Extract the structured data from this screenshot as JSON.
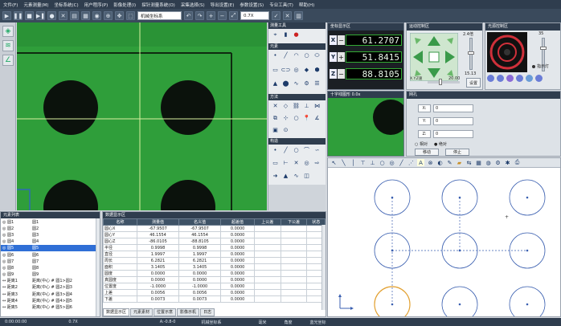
{
  "menubar": {
    "items": [
      "文件(F)",
      "元素测量(M)",
      "坐标系统(C)",
      "用户程序(P)",
      "影像处理(I)",
      "探针测量系统(O)",
      "采集选择(S)",
      "导出设置(E)",
      "参数设置(S)",
      "专业工具(T)",
      "帮助(H)"
    ]
  },
  "toolbar": {
    "coord_system": "机械坐标系",
    "zoom": "0.7X"
  },
  "camera": {
    "title": "",
    "crosshair_color": "#d8f0a0",
    "accent": "#2f9e3a"
  },
  "palette": {
    "measure_tools_title": "测量工具",
    "elements_title": "元素",
    "construct_title": "构造",
    "methods_title": "方法",
    "pattern_title": "构造"
  },
  "dro": {
    "title": "坐标显示区",
    "rows": [
      {
        "axis": "X",
        "sign": "−",
        "value": "61.2707"
      },
      {
        "axis": "Y",
        "sign": "+",
        "value": "51.8415"
      },
      {
        "axis": "Z",
        "sign": "−",
        "value": "88.8105"
      }
    ]
  },
  "motion": {
    "title": "运动控制区",
    "speed_label": "2.4倍",
    "speed_value": "15.13",
    "xy_label": "X.Y.Z速",
    "xy_value": "20.00",
    "set_button": "设置"
  },
  "light": {
    "title": "光源控制区",
    "level": "35",
    "indicator": "指示灯"
  },
  "subcam": {
    "title": "十字线图形 0.0x"
  },
  "axes": {
    "title": "网孔",
    "x_label": "X:",
    "x_value": "0",
    "y_label": "Y:",
    "y_value": "0",
    "z_label": "Z:",
    "z_value": "0",
    "relative": "相对",
    "absolute": "绝对",
    "move_button": "移动",
    "stop_button": "停止"
  },
  "element_list": {
    "title": "元素列表",
    "items": [
      {
        "id": "◎ 圆1",
        "desc": "圆1"
      },
      {
        "id": "◎ 圆2",
        "desc": "圆2"
      },
      {
        "id": "◎ 圆3",
        "desc": "圆3"
      },
      {
        "id": "◎ 圆4",
        "desc": "圆4"
      },
      {
        "id": "◎ 圆5",
        "desc": "圆5"
      },
      {
        "id": "◎ 圆6",
        "desc": "圆6"
      },
      {
        "id": "◎ 圆7",
        "desc": "圆7"
      },
      {
        "id": "◎ 圆8",
        "desc": "圆8"
      },
      {
        "id": "◎ 圆9",
        "desc": "圆9"
      },
      {
        "id": "↔ 距离1",
        "desc": "距离(中心 # 圆1>圆2"
      },
      {
        "id": "↔ 距离2",
        "desc": "距离(中心 # 圆2>圆3"
      },
      {
        "id": "↔ 距离3",
        "desc": "距离(中心 # 圆3>圆4"
      },
      {
        "id": "↔ 距离4",
        "desc": "距离(中心 # 圆4>圆5"
      },
      {
        "id": "↔ 距离5",
        "desc": "距离(中心 # 圆5>圆6"
      }
    ]
  },
  "data_table": {
    "title": "数据显示区",
    "headers": [
      "名称",
      "测量值",
      "名义值",
      "超差值",
      "上公差",
      "下公差",
      "状态"
    ],
    "rows": [
      [
        "圆心X",
        "-67.9507",
        "-67.9507",
        "0.0000"
      ],
      [
        "圆心Y",
        "46.1554",
        "46.1554",
        "0.0000"
      ],
      [
        "圆心Z",
        "-86.0105",
        "-88.8105",
        "0.0000"
      ],
      [
        "半径",
        "0.9998",
        "0.9998",
        "0.0000"
      ],
      [
        "直径",
        "1.9997",
        "1.9997",
        "0.0000"
      ],
      [
        "周长",
        "6.2821",
        "6.2821",
        "0.0000"
      ],
      [
        "面积",
        "3.1405",
        "3.1405",
        "0.0000"
      ],
      [
        "圆度",
        "0.0000",
        "0.0000",
        "0.0000"
      ],
      [
        "真圆度",
        "0.0000",
        "0.0000",
        "0.0000"
      ],
      [
        "位置度",
        "-1.0000",
        "-1.0000",
        "0.0000"
      ],
      [
        "上差",
        "0.0056",
        "0.0056",
        "0.0000"
      ],
      [
        "下差",
        "0.0073",
        "0.0073",
        "0.0000"
      ]
    ],
    "tabs": [
      "数据显示区",
      "元素素材",
      "位置示意",
      "影像示机",
      "日志"
    ]
  },
  "status": {
    "time": "0:00:00:00",
    "zoom": "0.7X",
    "coords": "A:-0.8-0",
    "system": "机械坐标系",
    "unit": "毫米",
    "angle": "角度",
    "light": "蓝光坐标"
  },
  "colors": {
    "accent_blue": "#2f6fd6",
    "highlight_orange": "#e2a030",
    "dark_header": "#2f3d4e"
  }
}
